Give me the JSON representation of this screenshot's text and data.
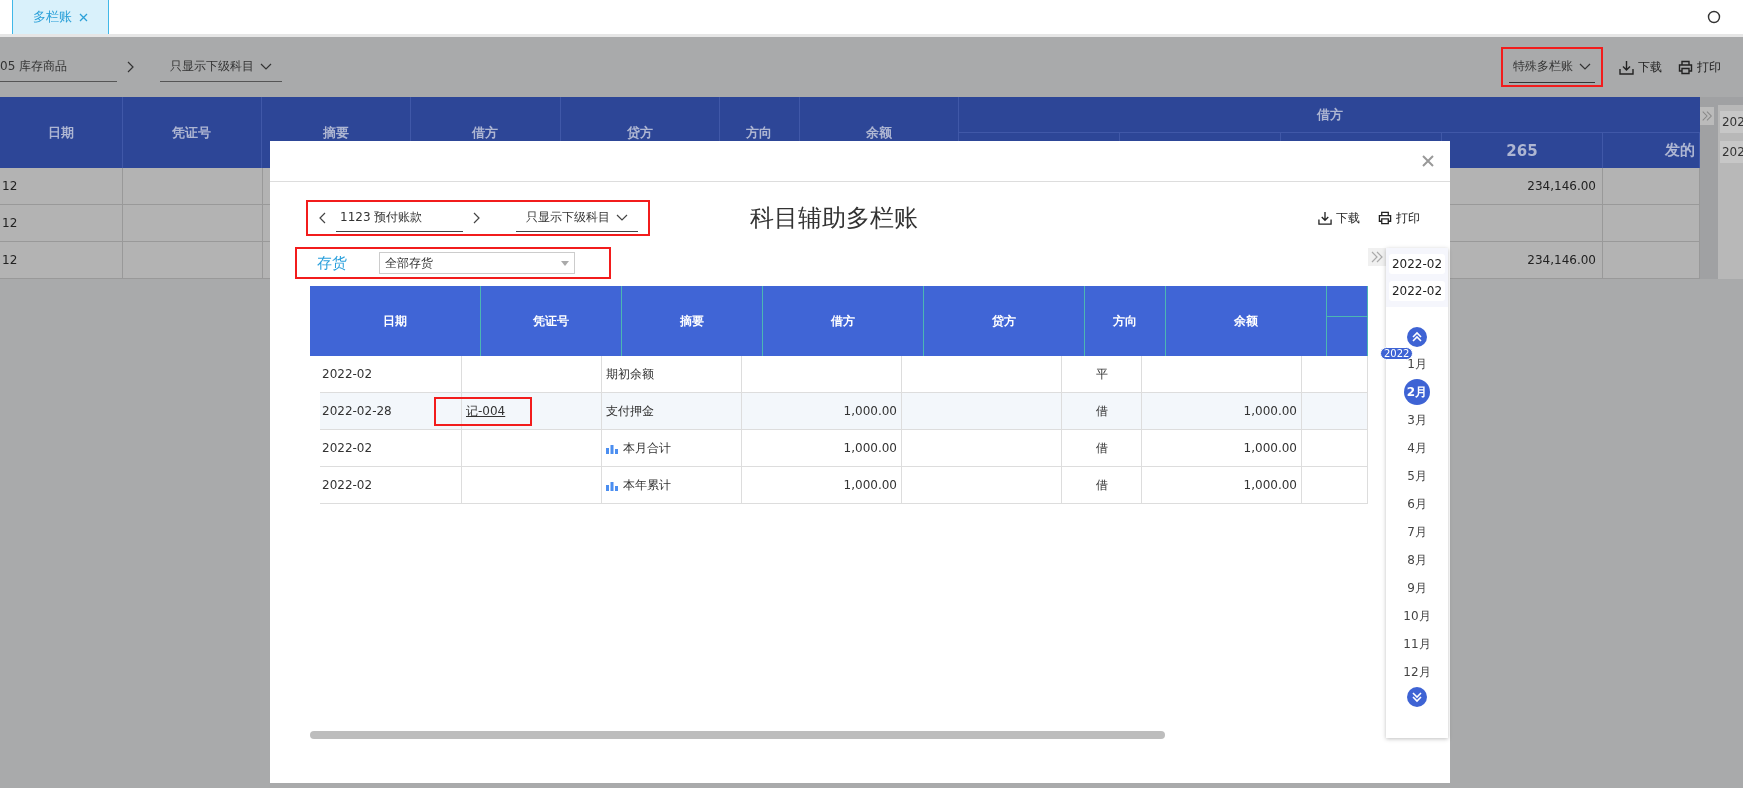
{
  "tabs": [
    {
      "label": "多栏账",
      "selected": true
    }
  ],
  "background": {
    "subject": "05  库存商品",
    "filter": "只显示下级科目",
    "ledger_type": {
      "label": "特殊多栏账",
      "highlighted": true
    },
    "actions": [
      {
        "kind": "download",
        "label": "下载"
      },
      {
        "kind": "print",
        "label": "打印"
      }
    ],
    "table": {
      "columns": [
        "日期",
        "凭证号",
        "摘要",
        "借方",
        "贷方",
        "方向",
        "余额"
      ],
      "group_header": "借方",
      "sub_columns": [
        "265",
        "发的"
      ],
      "rows": [
        {
          "date": "12",
          "amount": "234,146.00"
        },
        {
          "date": "12"
        },
        {
          "date": "12",
          "amount": "234,146.00"
        }
      ]
    },
    "side_panel": {
      "periods": [
        "202",
        "202"
      ]
    }
  },
  "dialog": {
    "title": "科目辅助多栏账",
    "subject": {
      "label": "1123  预付账款",
      "highlighted": true
    },
    "filter": "只显示下级科目",
    "actions": [
      {
        "kind": "download",
        "label": "下载"
      },
      {
        "kind": "print",
        "label": "打印"
      }
    ],
    "aux": {
      "label": "存货",
      "value": "全部存货",
      "highlighted": true
    },
    "table": {
      "columns": [
        "日期",
        "凭证号",
        "摘要",
        "借方",
        "贷方",
        "方向",
        "余额"
      ],
      "rows": [
        {
          "kind": "opening",
          "date": "2022-02",
          "summary": "期初余额",
          "direction": "平"
        },
        {
          "kind": "entry",
          "date": "2022-02-28",
          "voucher": {
            "text": "记-004",
            "highlighted": true
          },
          "summary": "支付押金",
          "debit": "1,000.00",
          "direction": "借",
          "balance": "1,000.00"
        },
        {
          "kind": "total",
          "date": "2022-02",
          "summary": "本月合计",
          "debit": "1,000.00",
          "direction": "借",
          "balance": "1,000.00"
        },
        {
          "kind": "total",
          "date": "2022-02",
          "summary": "本年累计",
          "debit": "1,000.00",
          "direction": "借",
          "balance": "1,000.00"
        }
      ]
    },
    "period_panel": {
      "start": "2022-02",
      "end": "2022-02",
      "year": "2022",
      "months": [
        {
          "label": "1月",
          "selected": false
        },
        {
          "label": "2月",
          "selected": true
        },
        {
          "label": "3月",
          "selected": false
        },
        {
          "label": "4月",
          "selected": false
        },
        {
          "label": "5月",
          "selected": false
        },
        {
          "label": "6月",
          "selected": false
        },
        {
          "label": "7月",
          "selected": false
        },
        {
          "label": "8月",
          "selected": false
        },
        {
          "label": "9月",
          "selected": false
        },
        {
          "label": "10月",
          "selected": false
        },
        {
          "label": "11月",
          "selected": false
        },
        {
          "label": "12月",
          "selected": false
        }
      ]
    }
  }
}
